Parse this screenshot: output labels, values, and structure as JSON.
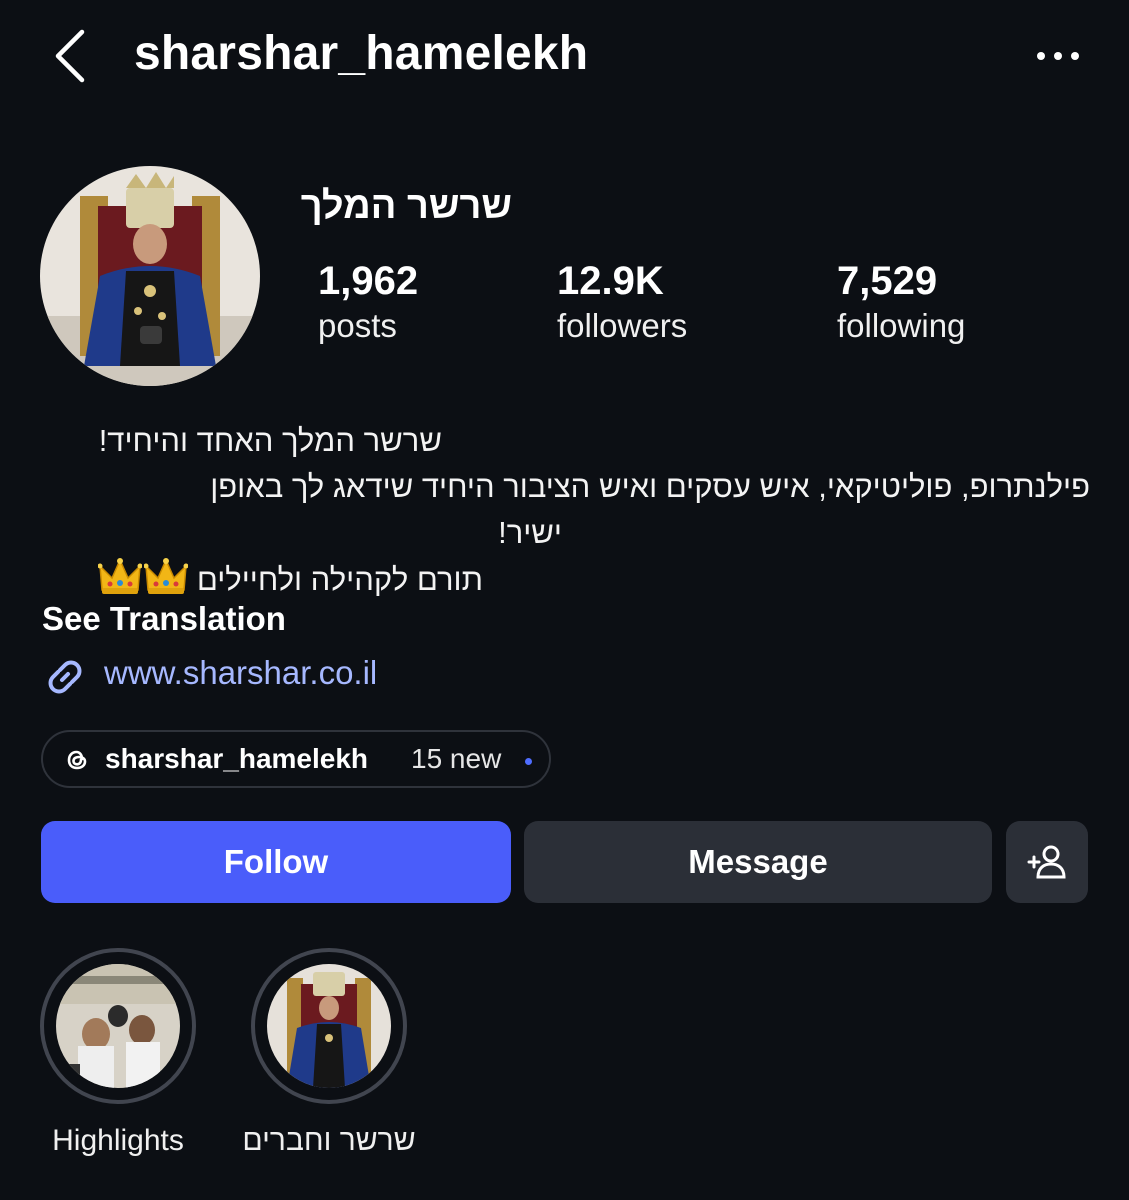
{
  "header": {
    "username": "sharshar_hamelekh",
    "back_icon": "chevron-left-icon",
    "more_icon": "more-horizontal-icon"
  },
  "profile": {
    "display_name": "שרשר המלך",
    "avatar": "profile-photo-king-throne",
    "stats": {
      "posts_value": "1,962",
      "posts_label": "posts",
      "followers_value": "12.9K",
      "followers_label": "followers",
      "following_value": "7,529",
      "following_label": "following"
    },
    "bio": {
      "line1": "שרשר המלך האחד והיחיד!",
      "line2": "פילנתרופ, פוליטיקאי, איש עסקים ואיש הציבור היחיד שידאג לך באופן",
      "line3": "ישיר!",
      "line4": "תורם לקהילה ולחיילים",
      "line4_emoji": "crown-emoji"
    },
    "see_translation": "See Translation",
    "link": {
      "icon": "link-icon",
      "text": "www.sharshar.co.il"
    },
    "threads": {
      "icon": "threads-icon",
      "username": "sharshar_hamelekh",
      "new_text": "15 new"
    }
  },
  "actions": {
    "follow_label": "Follow",
    "message_label": "Message",
    "add_user_icon": "add-person-icon"
  },
  "highlights": [
    {
      "label": "Highlights"
    },
    {
      "label": "שרשר וחברים"
    }
  ],
  "colors": {
    "background": "#0c0f14",
    "follow_button": "#4a5dfa",
    "secondary_button": "#2b2f37",
    "link": "#a6b8ff",
    "unread_dot": "#4f6dff"
  }
}
